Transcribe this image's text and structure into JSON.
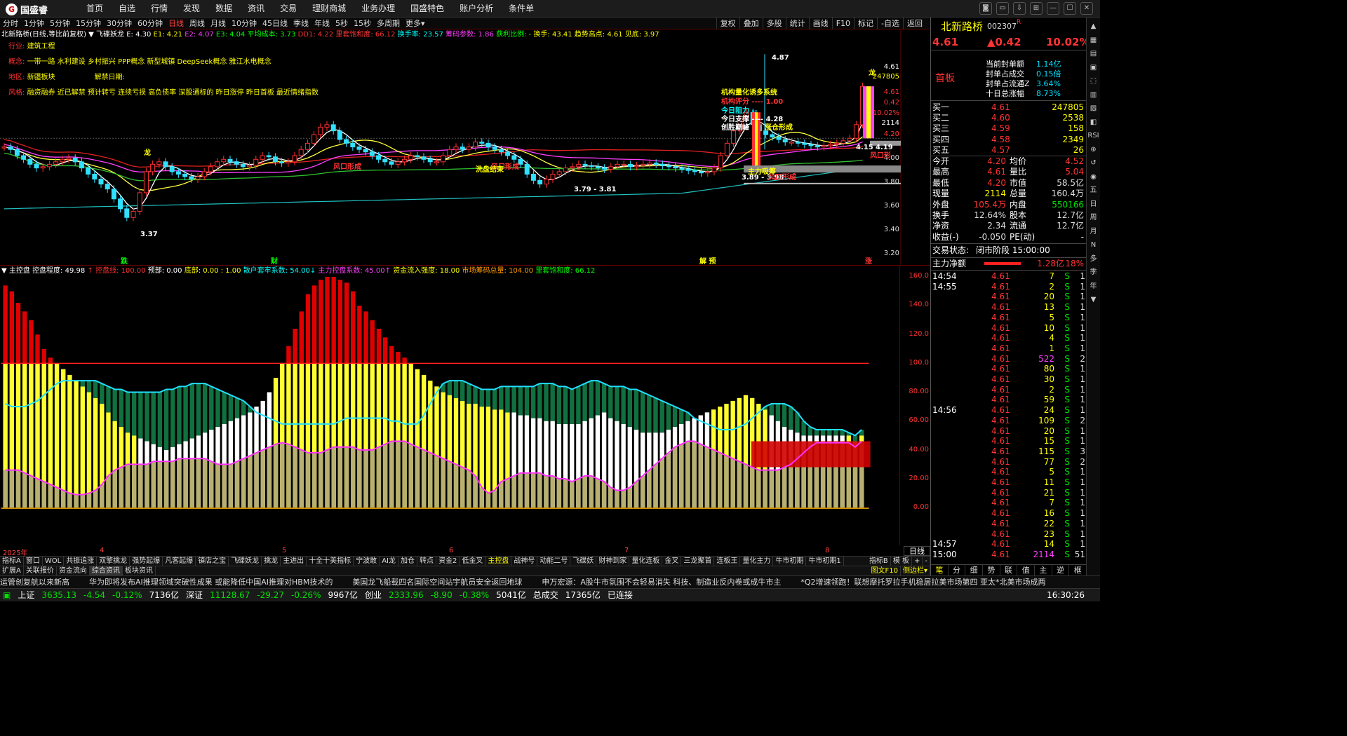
{
  "app": {
    "logo": "国盛睿",
    "menu": [
      "首页",
      "自选",
      "行情",
      "发现",
      "数据",
      "资讯",
      "交易",
      "理财商城",
      "业务办理",
      "国盛特色",
      "账户分析",
      "条件单"
    ]
  },
  "window_controls": [
    "◙",
    "▭",
    "⇩",
    "⊞",
    "—",
    "☐",
    "✕"
  ],
  "periods": [
    "分时",
    "1分钟",
    "5分钟",
    "15分钟",
    "30分钟",
    "60分钟",
    "日线",
    "周线",
    "月线",
    "10分钟",
    "45日线",
    "季线",
    "年线",
    "5秒",
    "15秒",
    "多周期",
    "更多▾"
  ],
  "active_period": "日线",
  "chart_tools": [
    "复权",
    "叠加",
    "多股",
    "统计",
    "画线",
    "F10",
    "标记",
    "-自选",
    "返回"
  ],
  "indicator_main": [
    {
      "t": "北新路桥(日线,等比前复权) ",
      "c": "#ffffff"
    },
    {
      "t": "▼ 飞碟妖龙 E: 4.30 ",
      "c": "#ffffff"
    },
    {
      "t": "E1: 4.21 ",
      "c": "#ffff00"
    },
    {
      "t": "E2: 4.07 ",
      "c": "#ff40ff"
    },
    {
      "t": "E3: 4.04 ",
      "c": "#00ff00"
    },
    {
      "t": "平均成本: 3.73 ",
      "c": "#00ff00"
    },
    {
      "t": "DD1: 4.22 ",
      "c": "#ff3333"
    },
    {
      "t": "里套饱和度: 66.12 ",
      "c": "#ff3333"
    },
    {
      "t": "换手率: 23.57 ",
      "c": "#00ffff"
    },
    {
      "t": "筹码参数: 1.86 ",
      "c": "#ff40ff"
    },
    {
      "t": "获利比例: - ",
      "c": "#00ff00"
    },
    {
      "t": "换手: 43.41 ",
      "c": "#ffff00"
    },
    {
      "t": "趋势高点: 4.61 ",
      "c": "#ffff00"
    },
    {
      "t": "见底: 3.97",
      "c": "#ffff00"
    }
  ],
  "stock_info": [
    {
      "label": "行业: ",
      "value": "建筑工程"
    },
    {
      "label": "概念: ",
      "value": "一带一路 水利建设 乡村振兴 PPP概念 新型城镇 DeepSeek概念 雅江水电概念"
    },
    {
      "label": "地区: ",
      "value": "新疆板块",
      "extra_label": "解禁日期: ",
      "extra_value": ""
    },
    {
      "label": "风格: ",
      "value": "融资融券 近已解禁 预计转亏 连续亏损 高负债率 深股通标的 昨日涨停 昨日首板 最近情绪指数"
    }
  ],
  "annotations": {
    "high": "4.87",
    "low1": "3.37",
    "low2": "3.79 - 3.81",
    "low3": "3.89 - 3.98",
    "p415": "4.15",
    "p419": "4.19",
    "dragon1": "龙",
    "dragon2": "龙",
    "fk1": "风口形成",
    "fk2": "风口形成",
    "fk3": "风口形成",
    "fk4": "风口形",
    "wash": "洗盘结束",
    "main_mid": "主力吸筹",
    "rise": "涨仓形成",
    "jg_title": "机构量化诱多系统",
    "jg_score": "机构评分 ---- 1.00",
    "resist": "今日阻力 --",
    "support": "今日支撑 ---- 4.28",
    "peak": "创胜巅峰",
    "marker_die": "跌",
    "marker_cai": "财",
    "marker_ye": "解 预",
    "marker_zhang": "涨"
  },
  "right_axis_main": [
    "4.61",
    "247805",
    "4.61",
    "0.42",
    "10.02%",
    "2114",
    "4.20",
    "4.00",
    "3.80",
    "3.60",
    "3.40",
    "3.20"
  ],
  "indicator_sub": [
    {
      "t": "▼ 主控盘 ",
      "c": "#ffffff"
    },
    {
      "t": "控盘程度: 49.98 ",
      "c": "#ffffff"
    },
    {
      "t": "↑ 控盘线: 100.00 ",
      "c": "#ff3333"
    },
    {
      "t": "预部: 0.00 ",
      "c": "#ffffff"
    },
    {
      "t": "底部: 0.00 : 1.00 ",
      "c": "#ffff00"
    },
    {
      "t": "散户套牢系数: 54.00↓ ",
      "c": "#00ffff"
    },
    {
      "t": "主力控盘系数: 45.00↑ ",
      "c": "#ff40ff"
    },
    {
      "t": "资金流入强度: 18.00 ",
      "c": "#ffff00"
    },
    {
      "t": "市场筹码总量: 104.00 ",
      "c": "#ff9900"
    },
    {
      "t": "里套饱和度: 66.12",
      "c": "#00ff00"
    }
  ],
  "right_axis_sub": [
    "160.0",
    "140.0",
    "120.0",
    "100.0",
    "80.00",
    "60.00",
    "40.00",
    "20.00",
    "0.00"
  ],
  "dates": [
    "2025年",
    "4",
    "5",
    "6",
    "7",
    "8"
  ],
  "period_label": "日线",
  "tabs_row1": [
    "指标A",
    "窗口",
    "WOL",
    "共振追涨",
    "双擎擒龙",
    "强势起爆",
    "凡客起爆",
    "镇店之宝",
    "飞碟妖龙",
    "擒龙",
    "主进出",
    "十全十美指标",
    "宁波敢",
    "AI龙",
    "加仓",
    "转点",
    "资金2",
    "低金叉",
    "主控盘",
    "战神号",
    "动能二号",
    "飞碟妖",
    "财神到家",
    "量化连板",
    "金叉",
    "三龙聚首",
    "连板王",
    "量化主力",
    "牛市初期",
    "牛市初期1"
  ],
  "tabs_row1_right": [
    "指标B",
    "模 板",
    "+",
    "-"
  ],
  "tabs_row2": [
    "扩展A",
    "关联报价",
    "资金流向",
    "综合资讯",
    "板块资讯"
  ],
  "tabs_row2_right": [
    "图文F10",
    "侧边栏▾"
  ],
  "news": [
    "运管创复航以来新高",
    "华为即将发布AI推理领域突破性成果 或能降低中国AI推理对HBM技术的",
    "美国龙飞船载四名国际空间站宇航员安全返回地球",
    "申万宏源：A股牛市氛围不会轻易消失 科技、制造业反内卷或成牛市主",
    "*Q2增速领跑！联想摩托罗拉手机稳居拉美市场第四 亚太*北美市场成两"
  ],
  "status": {
    "sh_name": "上证",
    "sh_val": "3635.13",
    "sh_chg": "-4.54",
    "sh_pct": "-0.12%",
    "sh_amt": "7136亿",
    "sz_name": "深证",
    "sz_val": "11128.67",
    "sz_chg": "-29.27",
    "sz_pct": "-0.26%",
    "sz_amt": "9967亿",
    "cy_name": "创业",
    "cy_val": "2333.96",
    "cy_chg": "-8.90",
    "cy_pct": "-0.38%",
    "cy_amt": "5041亿",
    "total_name": "总成交",
    "total_val": "17365亿",
    "conn": "已连接",
    "time": "16:30:26"
  },
  "quote": {
    "name": "北新路桥",
    "code": "002307",
    "flag": "R",
    "price": "4.61",
    "chg": "▲0.42",
    "pct": "10.02%",
    "tag": "首板",
    "seal": [
      {
        "k": "当前封单额",
        "v": "1.14亿"
      },
      {
        "k": "封单占成交",
        "v": "0.15倍"
      },
      {
        "k": "封单占流通Z",
        "v": "3.64%"
      },
      {
        "k": "十日总涨幅",
        "v": "8.73%"
      }
    ],
    "asks": [
      {
        "k": "卖一",
        "p": "",
        "v": ""
      },
      {
        "k": "卖二",
        "p": "",
        "v": ""
      },
      {
        "k": "卖三",
        "p": "",
        "v": ""
      },
      {
        "k": "卖四",
        "p": "",
        "v": ""
      },
      {
        "k": "卖五",
        "p": "",
        "v": ""
      }
    ],
    "bids": [
      {
        "k": "买一",
        "p": "4.61",
        "v": "247805"
      },
      {
        "k": "买二",
        "p": "4.60",
        "v": "2538"
      },
      {
        "k": "买三",
        "p": "4.59",
        "v": "158"
      },
      {
        "k": "买四",
        "p": "4.58",
        "v": "2349"
      },
      {
        "k": "买五",
        "p": "4.57",
        "v": "26"
      }
    ],
    "stats": [
      {
        "k1": "今开",
        "v1": "4.20",
        "k2": "均价",
        "v2": "4.52",
        "c1": "#ff3333",
        "c2": "#ff3333"
      },
      {
        "k1": "最高",
        "v1": "4.61",
        "k2": "量比",
        "v2": "5.04",
        "c1": "#ff3333",
        "c2": "#ff3333"
      },
      {
        "k1": "最低",
        "v1": "4.20",
        "k2": "市值",
        "v2": "58.5亿",
        "c1": "#ff3333",
        "c2": "#dddddd"
      },
      {
        "k1": "现量",
        "v1": "2114",
        "k2": "总量",
        "v2": "160.4万",
        "c1": "#ffff00",
        "c2": "#dddddd"
      },
      {
        "k1": "外盘",
        "v1": "105.4万",
        "k2": "内盘",
        "v2": "550166",
        "c1": "#ff3333",
        "c2": "#00e000"
      },
      {
        "k1": "换手",
        "v1": "12.64%",
        "k2": "股本",
        "v2": "12.7亿",
        "c1": "#dddddd",
        "c2": "#dddddd"
      },
      {
        "k1": "净资",
        "v1": "2.34",
        "k2": "流通",
        "v2": "12.7亿",
        "c1": "#dddddd",
        "c2": "#dddddd"
      },
      {
        "k1": "收益(-)",
        "v1": "-0.050",
        "k2": "PE(动)",
        "v2": "-",
        "c1": "#dddddd",
        "c2": "#dddddd"
      }
    ],
    "trade_state_label": "交易状态:",
    "trade_state": "闭市阶段 15:00:00",
    "net_label": "主力净额",
    "net_val": "1.28亿",
    "net_pct": "18%",
    "ticks": [
      {
        "t": "14:54",
        "p": "4.61",
        "v": "7",
        "s": "S",
        "n": "1"
      },
      {
        "t": "14:55",
        "p": "4.61",
        "v": "2",
        "s": "S",
        "n": "1"
      },
      {
        "t": "",
        "p": "4.61",
        "v": "20",
        "s": "S",
        "n": "1"
      },
      {
        "t": "",
        "p": "4.61",
        "v": "13",
        "s": "S",
        "n": "1"
      },
      {
        "t": "",
        "p": "4.61",
        "v": "5",
        "s": "S",
        "n": "1"
      },
      {
        "t": "",
        "p": "4.61",
        "v": "10",
        "s": "S",
        "n": "1"
      },
      {
        "t": "",
        "p": "4.61",
        "v": "4",
        "s": "S",
        "n": "1"
      },
      {
        "t": "",
        "p": "4.61",
        "v": "1",
        "s": "S",
        "n": "1"
      },
      {
        "t": "",
        "p": "4.61",
        "v": "522",
        "s": "S",
        "n": "2"
      },
      {
        "t": "",
        "p": "4.61",
        "v": "80",
        "s": "S",
        "n": "1"
      },
      {
        "t": "",
        "p": "4.61",
        "v": "30",
        "s": "S",
        "n": "1"
      },
      {
        "t": "",
        "p": "4.61",
        "v": "2",
        "s": "S",
        "n": "1"
      },
      {
        "t": "",
        "p": "4.61",
        "v": "59",
        "s": "S",
        "n": "1"
      },
      {
        "t": "14:56",
        "p": "4.61",
        "v": "24",
        "s": "S",
        "n": "1"
      },
      {
        "t": "",
        "p": "4.61",
        "v": "109",
        "s": "S",
        "n": "2"
      },
      {
        "t": "",
        "p": "4.61",
        "v": "20",
        "s": "S",
        "n": "1"
      },
      {
        "t": "",
        "p": "4.61",
        "v": "15",
        "s": "S",
        "n": "1"
      },
      {
        "t": "",
        "p": "4.61",
        "v": "115",
        "s": "S",
        "n": "3"
      },
      {
        "t": "",
        "p": "4.61",
        "v": "77",
        "s": "S",
        "n": "2"
      },
      {
        "t": "",
        "p": "4.61",
        "v": "5",
        "s": "S",
        "n": "1"
      },
      {
        "t": "",
        "p": "4.61",
        "v": "11",
        "s": "S",
        "n": "1"
      },
      {
        "t": "",
        "p": "4.61",
        "v": "21",
        "s": "S",
        "n": "1"
      },
      {
        "t": "",
        "p": "4.61",
        "v": "7",
        "s": "S",
        "n": "1"
      },
      {
        "t": "",
        "p": "4.61",
        "v": "16",
        "s": "S",
        "n": "1"
      },
      {
        "t": "",
        "p": "4.61",
        "v": "22",
        "s": "S",
        "n": "1"
      },
      {
        "t": "",
        "p": "4.61",
        "v": "23",
        "s": "S",
        "n": "1"
      },
      {
        "t": "14:57",
        "p": "4.61",
        "v": "14",
        "s": "S",
        "n": "1"
      },
      {
        "t": "15:00",
        "p": "4.61",
        "v": "2114",
        "s": "S",
        "n": "51"
      }
    ],
    "bottom_tabs": [
      "笔",
      "分",
      "细",
      "势",
      "联",
      "值",
      "主",
      "逆",
      "框"
    ]
  },
  "side_tools": [
    "▲",
    "▦",
    "▤",
    "▣",
    "⬚",
    "▥",
    "▨",
    "◧",
    "RSI",
    "⊕",
    "↺",
    "◉",
    "五",
    "日",
    "周",
    "月",
    "N",
    "多",
    "季",
    "年",
    "▼"
  ],
  "chart_data": [
    {
      "type": "candlestick",
      "title": "北新路桥(日线,等比前复权)",
      "ylim": [
        3.2,
        4.9
      ],
      "yticks": [
        3.2,
        3.4,
        3.6,
        3.8,
        4.0,
        4.2
      ],
      "last_close": 4.61,
      "prev_close": 4.19,
      "high": 4.87,
      "low": 3.37
    },
    {
      "type": "bar",
      "title": "主控盘",
      "ylim": [
        0,
        160
      ],
      "yticks": [
        0,
        20,
        40,
        60,
        80,
        100,
        120,
        140,
        160
      ],
      "control_line": 100,
      "series": [
        {
          "name": "控盘程度",
          "color": "#ff3333",
          "values": [
            154,
            150,
            142,
            136,
            130,
            120,
            110,
            104,
            100,
            96,
            92,
            88,
            84,
            80,
            76,
            72,
            66,
            60,
            56,
            52,
            50,
            48,
            46,
            44,
            42,
            40,
            42,
            44,
            46,
            48,
            50,
            52,
            54,
            56,
            58,
            60,
            62,
            64,
            66,
            70,
            74,
            80,
            90,
            100,
            112,
            124,
            136,
            148,
            154,
            158,
            160,
            160,
            158,
            156,
            150,
            140,
            136,
            130,
            124,
            118,
            112,
            108,
            104,
            100,
            96,
            92,
            88,
            84,
            80,
            78,
            76,
            74,
            72,
            72,
            70,
            70,
            68,
            68,
            66,
            66,
            64,
            64,
            62,
            62,
            60,
            60,
            58,
            58,
            58,
            58,
            60,
            62,
            64,
            66,
            62,
            60,
            58,
            56,
            54,
            52,
            52,
            52,
            52,
            54,
            56,
            58,
            60,
            62,
            64,
            66,
            68,
            70,
            72,
            74,
            76,
            78,
            76,
            72,
            68,
            64,
            60,
            56,
            54,
            52,
            50,
            50,
            50,
            50,
            50,
            50,
            50,
            50,
            46,
            50
          ]
        },
        {
          "name": "散户套牢系数",
          "color": "#00e0ff",
          "values": [
            72,
            70,
            70,
            70,
            72,
            74,
            78,
            82,
            86,
            88,
            88,
            88,
            88,
            88,
            88,
            86,
            84,
            82,
            82,
            80,
            80,
            80,
            80,
            80,
            80,
            82,
            82,
            84,
            84,
            86,
            86,
            86,
            84,
            82,
            80,
            78,
            76,
            74,
            70,
            66,
            64,
            62,
            60,
            58,
            58,
            58,
            58,
            58,
            58,
            58,
            58,
            58,
            60,
            62,
            62,
            62,
            62,
            62,
            62,
            62,
            60,
            60,
            58,
            58,
            58,
            64,
            72,
            80,
            86,
            88,
            88,
            88,
            86,
            84,
            82,
            82,
            82,
            84,
            84,
            84,
            84,
            84,
            84,
            86,
            86,
            86,
            84,
            84,
            82,
            84,
            86,
            88,
            88,
            86,
            84,
            84,
            84,
            82,
            82,
            80,
            78,
            76,
            74,
            72,
            70,
            68,
            66,
            62,
            60,
            58,
            56,
            54,
            54,
            54,
            56,
            58,
            62,
            66,
            70,
            72,
            72,
            72,
            70,
            66,
            60,
            56,
            54,
            54,
            54,
            54,
            54,
            52,
            50,
            54
          ]
        },
        {
          "name": "主力控盘系数",
          "color": "#ff40ff",
          "values": [
            26,
            26,
            26,
            24,
            22,
            20,
            18,
            16,
            14,
            12,
            10,
            9,
            9,
            10,
            12,
            16,
            22,
            26,
            28,
            30,
            30,
            30,
            30,
            32,
            32,
            32,
            32,
            34,
            34,
            34,
            34,
            34,
            32,
            30,
            30,
            30,
            32,
            34,
            36,
            38,
            40,
            42,
            44,
            45,
            44,
            42,
            40,
            38,
            38,
            38,
            40,
            42,
            42,
            42,
            42,
            40,
            40,
            40,
            42,
            44,
            46,
            46,
            46,
            44,
            42,
            40,
            38,
            36,
            34,
            32,
            30,
            28,
            26,
            22,
            14,
            10,
            12,
            18,
            20,
            22,
            24,
            24,
            24,
            24,
            22,
            22,
            20,
            20,
            18,
            20,
            22,
            22,
            20,
            18,
            14,
            12,
            12,
            14,
            18,
            22,
            26,
            30,
            34,
            38,
            42,
            44,
            46,
            46,
            44,
            42,
            40,
            38,
            36,
            34,
            32,
            30,
            28,
            26,
            26,
            26,
            26,
            28,
            30,
            34,
            38,
            42,
            45,
            45,
            45,
            45,
            45,
            45,
            42,
            46
          ]
        }
      ]
    }
  ]
}
